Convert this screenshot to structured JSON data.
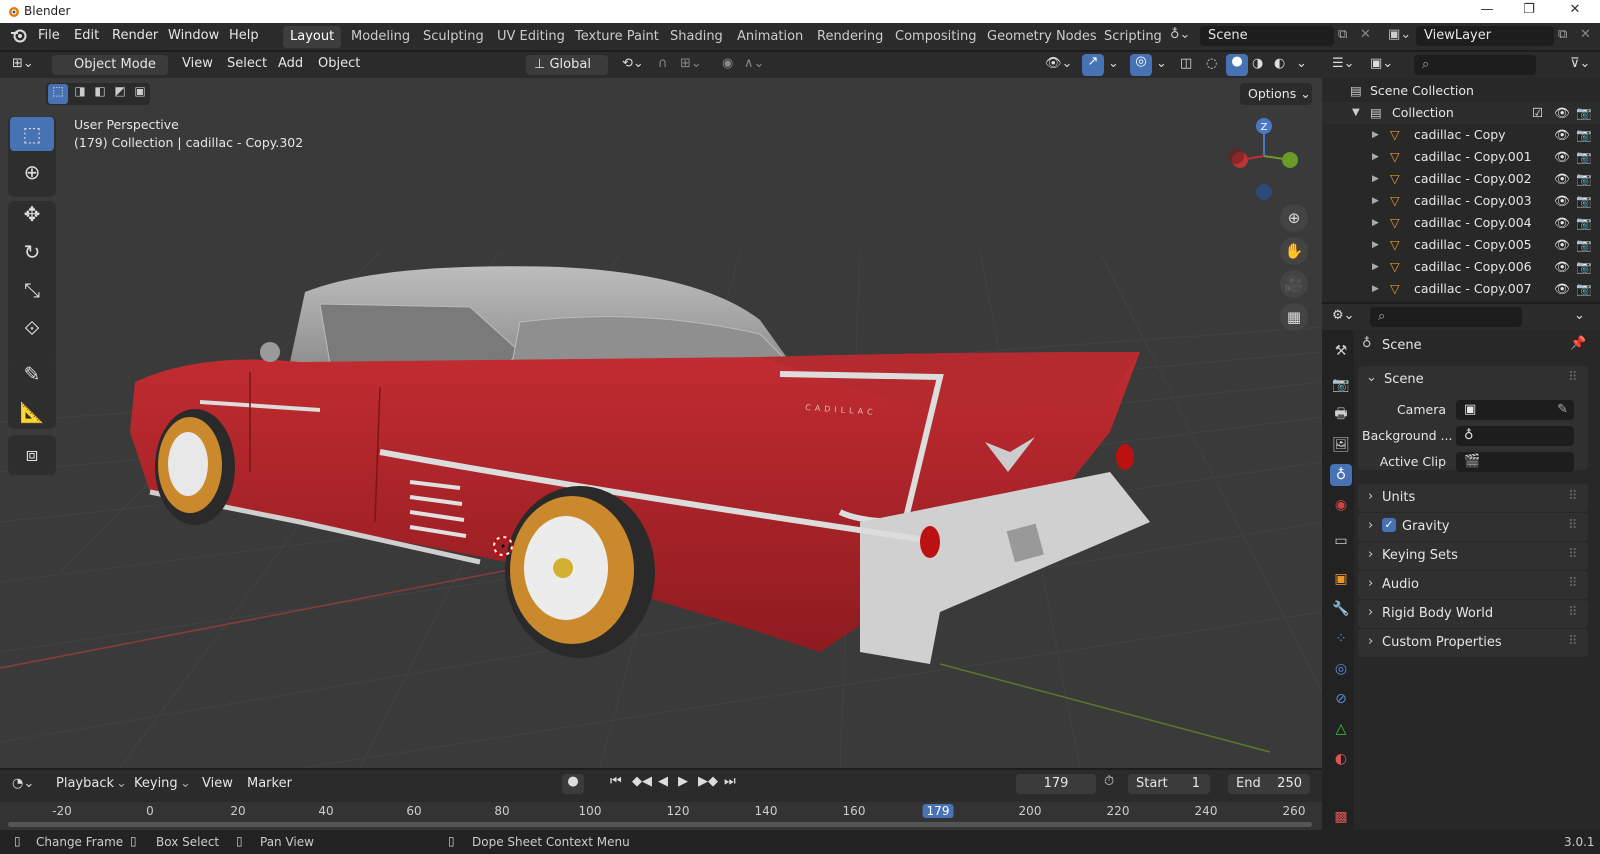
{
  "window": {
    "title": "Blender",
    "version": "3.0.1"
  },
  "menus": [
    "File",
    "Edit",
    "Render",
    "Window",
    "Help"
  ],
  "workspaces": [
    "Layout",
    "Modeling",
    "Sculpting",
    "UV Editing",
    "Texture Paint",
    "Shading",
    "Animation",
    "Rendering",
    "Compositing",
    "Geometry Nodes",
    "Scripting"
  ],
  "active_workspace": "Layout",
  "scene_field": "Scene",
  "viewlayer_field": "ViewLayer",
  "viewport": {
    "mode": "Object Mode",
    "menus": [
      "View",
      "Select",
      "Add",
      "Object"
    ],
    "transform_orientation": "Global",
    "options_label": "Options",
    "info_line1": "User Perspective",
    "info_line2": "(179) Collection | cadillac - Copy.302",
    "gizmo_z": "Z",
    "car_badge": "CADILLAC"
  },
  "outliner": {
    "root": "Scene Collection",
    "collection": "Collection",
    "items": [
      "cadillac - Copy",
      "cadillac - Copy.001",
      "cadillac - Copy.002",
      "cadillac - Copy.003",
      "cadillac - Copy.004",
      "cadillac - Copy.005",
      "cadillac - Copy.006",
      "cadillac - Copy.007"
    ]
  },
  "properties": {
    "context": "Scene",
    "panel_title": "Scene",
    "fields": [
      {
        "label": "Camera"
      },
      {
        "label": "Background ..."
      },
      {
        "label": "Active Clip"
      }
    ],
    "panels": [
      "Units",
      "Gravity",
      "Keying Sets",
      "Audio",
      "Rigid Body World",
      "Custom Properties"
    ],
    "gravity_checked": true
  },
  "timeline": {
    "menus": [
      "Playback",
      "Keying",
      "View",
      "Marker"
    ],
    "current_frame": "179",
    "start_label": "Start",
    "start_value": "1",
    "end_label": "End",
    "end_value": "250",
    "ticks": [
      "-20",
      "0",
      "20",
      "40",
      "60",
      "80",
      "100",
      "120",
      "140",
      "160",
      "179",
      "200",
      "220",
      "240",
      "260"
    ]
  },
  "statusbar": {
    "items": [
      "Change Frame",
      "Box Select",
      "Pan View",
      "Dope Sheet Context Menu"
    ]
  },
  "colors": {
    "accent": "#4772b3",
    "car_body": "#b3262c",
    "chrome": "#d8d8d8",
    "roof": "#a8a8a8"
  }
}
